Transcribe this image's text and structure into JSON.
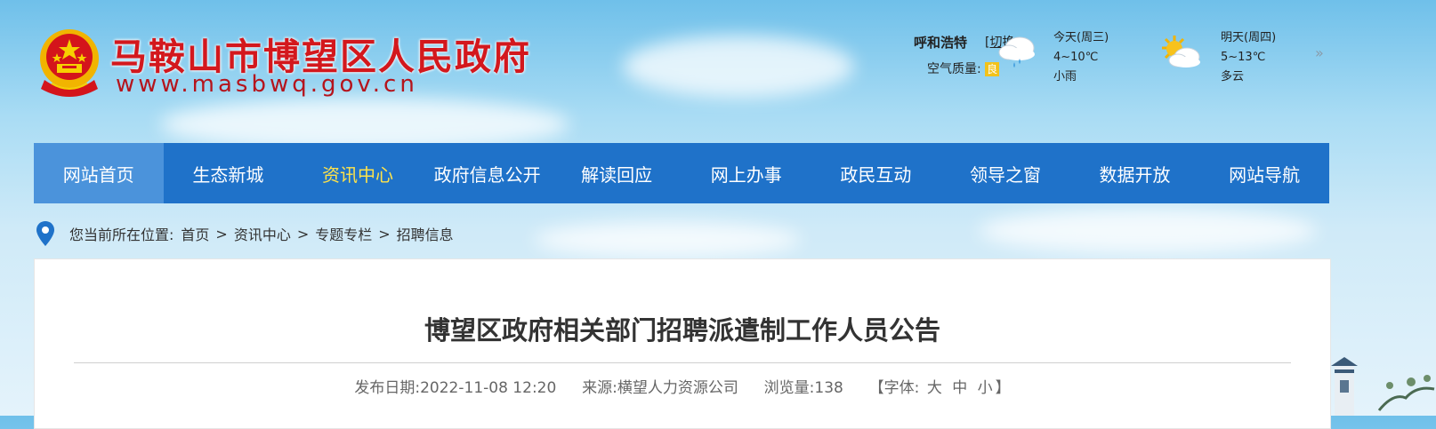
{
  "header": {
    "site_title": "马鞍山市博望区人民政府",
    "site_url": "www.masbwq.gov.cn"
  },
  "weather": {
    "city": "呼和浩特",
    "switch_label": "切换",
    "air_quality_label": "空气质量:",
    "air_quality_value": "良",
    "today": {
      "label": "今天(周三)",
      "temp": "4~10℃",
      "condition": "小雨",
      "icon": "rain-cloud-icon"
    },
    "tomorrow": {
      "label": "明天(周四)",
      "temp": "5~13℃",
      "condition": "多云",
      "icon": "sun-cloud-icon"
    }
  },
  "nav": {
    "items": [
      "网站首页",
      "生态新城",
      "资讯中心",
      "政府信息公开",
      "解读回应",
      "网上办事",
      "政民互动",
      "领导之窗",
      "数据开放",
      "网站导航"
    ]
  },
  "breadcrumb": {
    "prefix": "您当前所在位置:",
    "items": [
      "首页",
      "资讯中心",
      "专题专栏",
      "招聘信息"
    ],
    "separator": ">"
  },
  "article": {
    "title": "博望区政府相关部门招聘派遣制工作人员公告",
    "date_label": "发布日期:",
    "date": "2022-11-08 12:20",
    "source_label": "来源:",
    "source": "横望人力资源公司",
    "views_label": "浏览量:",
    "views": "138",
    "font_label": "【字体:",
    "font_large": "大",
    "font_medium": "中",
    "font_small": "小",
    "font_close": "】"
  },
  "colors": {
    "nav_bg": "#1f72c9",
    "nav_active_text": "#ffe34a",
    "title_red": "#d3181d"
  }
}
